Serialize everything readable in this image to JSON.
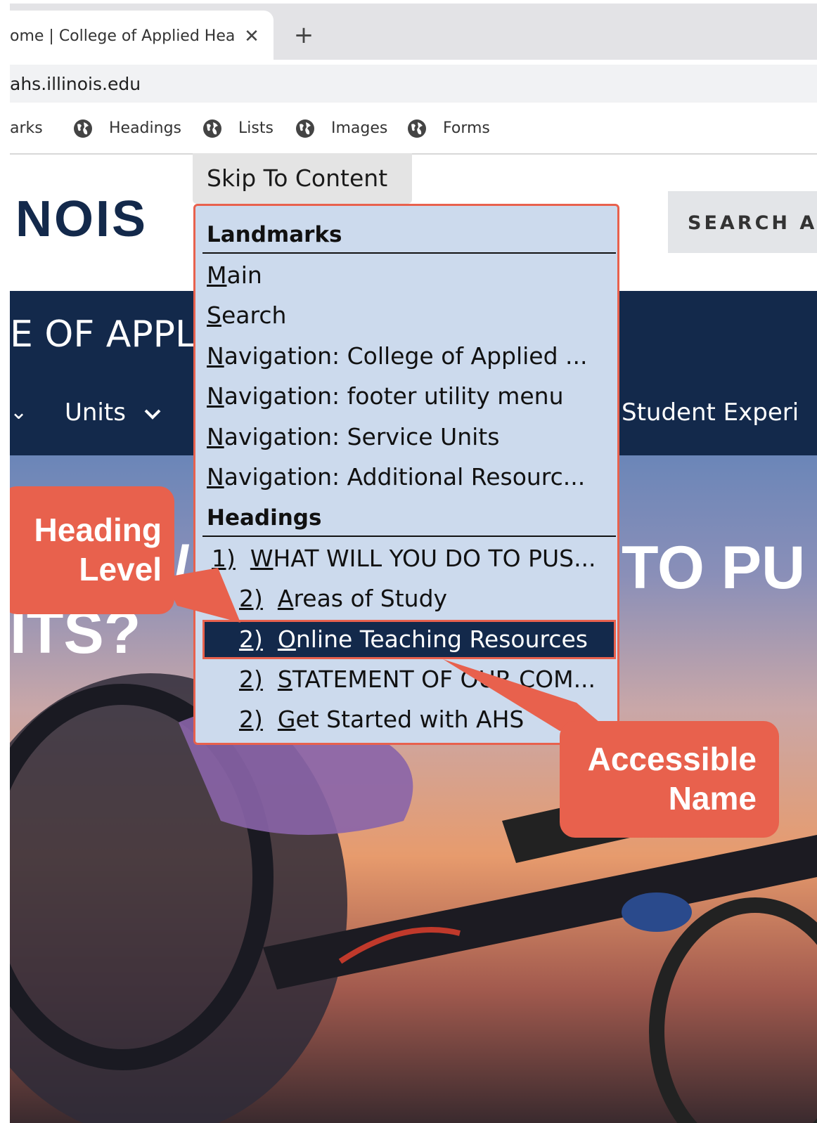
{
  "browser": {
    "tab_title": "ome | College of Applied Heal",
    "tab_close": "✕",
    "new_tab": "+",
    "address": "ahs.illinois.edu",
    "bookmarks": [
      {
        "label": "arks",
        "icon": "globe-icon"
      },
      {
        "label": "Headings",
        "icon": "globe-icon"
      },
      {
        "label": "Lists",
        "icon": "globe-icon"
      },
      {
        "label": "Images",
        "icon": "globe-icon"
      },
      {
        "label": "Forms",
        "icon": "globe-icon"
      }
    ]
  },
  "page": {
    "logo_text": "NOIS",
    "search_button": "SEARCH A",
    "college_name": "E OF APPL",
    "nav_left_chevron": "⌄",
    "nav_units": "Units",
    "nav_student": "Student Experi",
    "hero_right": "TO PU",
    "hero_left": "ITS?",
    "hero_slash": "/"
  },
  "skip_link": "Skip To Content",
  "skipto_menu": {
    "landmarks_header": "Landmarks",
    "landmarks": [
      {
        "key": "M",
        "rest": "ain"
      },
      {
        "key": "S",
        "rest": "earch"
      },
      {
        "key": "N",
        "rest": "avigation: College of Applied ..."
      },
      {
        "key": "N",
        "rest": "avigation: footer utility menu"
      },
      {
        "key": "N",
        "rest": "avigation: Service Units"
      },
      {
        "key": "N",
        "rest": "avigation: Additional Resourc..."
      }
    ],
    "headings_header": "Headings",
    "headings": [
      {
        "level": "1)",
        "key": "W",
        "rest": "HAT WILL YOU DO TO PUS..."
      },
      {
        "level": "2)",
        "key": "A",
        "rest": "reas of Study"
      },
      {
        "level": "2)",
        "key": "O",
        "rest": "nline Teaching Resources"
      },
      {
        "level": "2)",
        "key": "S",
        "rest": "TATEMENT OF OUR COM..."
      },
      {
        "level": "2)",
        "key": "G",
        "rest": "et Started with AHS"
      }
    ]
  },
  "callouts": {
    "heading_level": [
      "Heading",
      "Level"
    ],
    "accessible_name": [
      "Accessible",
      "Name"
    ]
  },
  "colors": {
    "accent": "#e8614d",
    "brand_navy": "#13294b",
    "menu_bg": "#ccdaed"
  }
}
